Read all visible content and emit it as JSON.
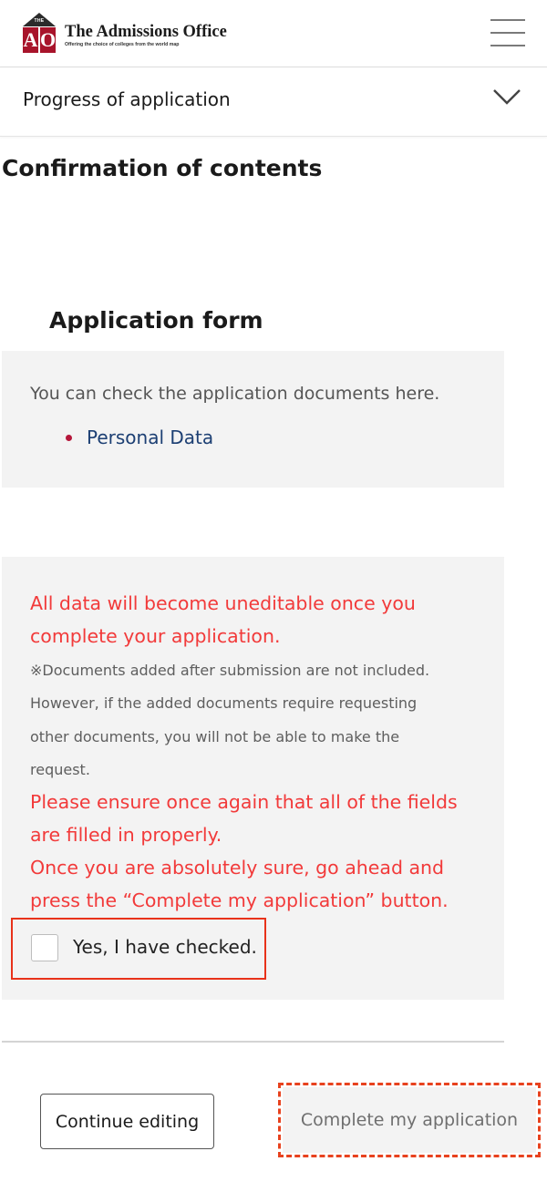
{
  "header": {
    "logo_the": "THE",
    "logo_letter_a": "A",
    "logo_letter_o": "O",
    "logo_title": "The Admissions Office",
    "logo_tagline": "Offering the choice of colleges from the world map",
    "menu_icon": "hamburger-menu-icon"
  },
  "progress": {
    "label": "Progress of application",
    "icon": "chevron-down-icon"
  },
  "page": {
    "title": "Confirmation of contents"
  },
  "application_form": {
    "title": "Application form",
    "intro": "You can check the application documents here.",
    "documents": [
      "Personal Data"
    ]
  },
  "warning": {
    "line1": "All data will become uneditable once you",
    "line2": "complete your application.",
    "note1": "※Documents added after submission are not included.",
    "note2": "However, if the added documents require requesting",
    "note3": "other documents, you will not be able to make the",
    "note4": "request.",
    "line3": "Please ensure once again that all of the fields",
    "line4": "are filled in properly.",
    "line5": "Once you are absolutely sure, go ahead and",
    "line6": "press the “Complete my application” button.",
    "checkbox_label": "Yes, I have checked.",
    "checkbox_checked": false
  },
  "actions": {
    "continue_label": "Continue editing",
    "complete_label": "Complete my application"
  },
  "colors": {
    "brand_red": "#a8142b",
    "warning_red": "#f23a3a",
    "highlight_orange": "#e8321a",
    "link_blue": "#1c3f73",
    "panel_gray": "#f3f3f3"
  }
}
